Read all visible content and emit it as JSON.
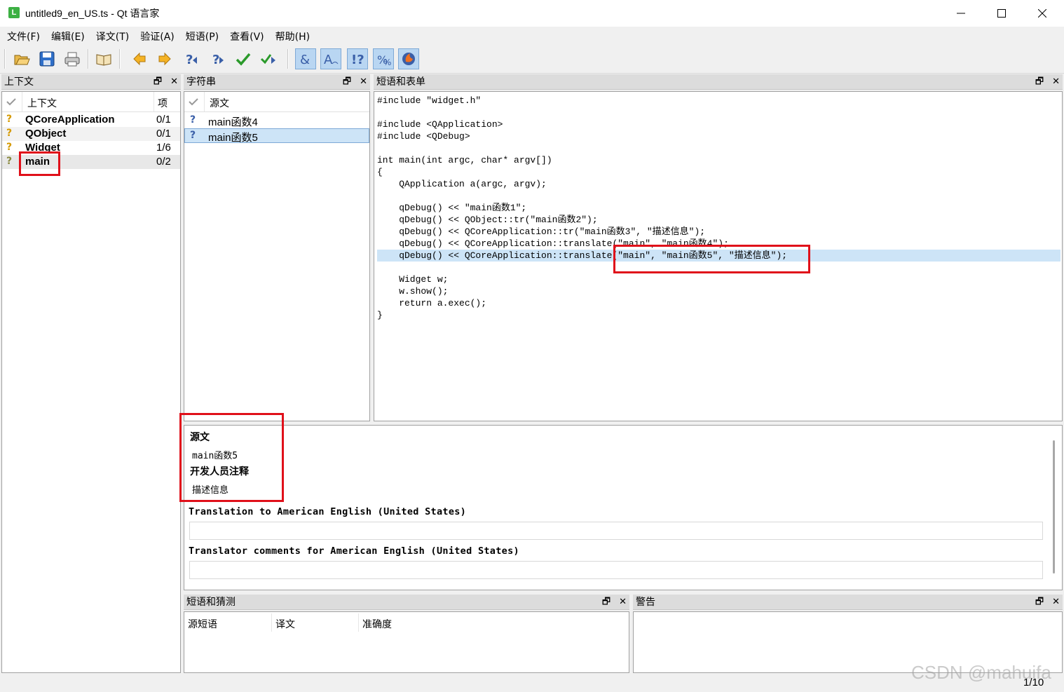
{
  "window": {
    "title": "untitled9_en_US.ts - Qt 语言家",
    "app_icon": "L"
  },
  "menu": [
    "文件(F)",
    "编辑(E)",
    "译文(T)",
    "验证(A)",
    "短语(P)",
    "查看(V)",
    "帮助(H)"
  ],
  "context_panel": {
    "title": "上下文",
    "col_context": "上下文",
    "col_items": "项",
    "rows": [
      {
        "name": "QCoreApplication",
        "count": "0/1"
      },
      {
        "name": "QObject",
        "count": "0/1"
      },
      {
        "name": "Widget",
        "count": "1/6"
      },
      {
        "name": "main",
        "count": "0/2"
      }
    ]
  },
  "strings_panel": {
    "title": "字符串",
    "col_source": "源文",
    "rows": [
      {
        "text": "main函数4"
      },
      {
        "text": "main函数5"
      }
    ]
  },
  "sources_panel": {
    "title": "短语和表单",
    "code": [
      "#include \"widget.h\"",
      "",
      "#include <QApplication>",
      "#include <QDebug>",
      "",
      "int main(int argc, char* argv[])",
      "{",
      "    QApplication a(argc, argv);",
      "",
      "    qDebug() << \"main函数1\";",
      "    qDebug() << QObject::tr(\"main函数2\");",
      "    qDebug() << QCoreApplication::tr(\"main函数3\", \"描述信息\");",
      "    qDebug() << QCoreApplication::translate(\"main\", \"main函数4\");",
      "    qDebug() << QCoreApplication::translate(\"main\", \"main函数5\", \"描述信息\");",
      "",
      "    Widget w;",
      "    w.show();",
      "    return a.exec();",
      "}"
    ]
  },
  "editor": {
    "source_heading": "源文",
    "source_text": "main函数5",
    "dev_comment_heading": "开发人员注释",
    "dev_comment_text": "描述信息",
    "translation_label": "Translation to American English (United States)",
    "translator_comments_label": "Translator comments for American English (United States)"
  },
  "phrases_panel": {
    "title": "短语和猜测",
    "col_source": "源短语",
    "col_translation": "译文",
    "col_accuracy": "准确度"
  },
  "warnings_panel": {
    "title": "警告"
  },
  "status": {
    "progress": "1/10"
  },
  "watermark": "CSDN @mahuifa",
  "colors": {
    "highlight": "#cde4f7",
    "annotation": "#e0101a"
  }
}
